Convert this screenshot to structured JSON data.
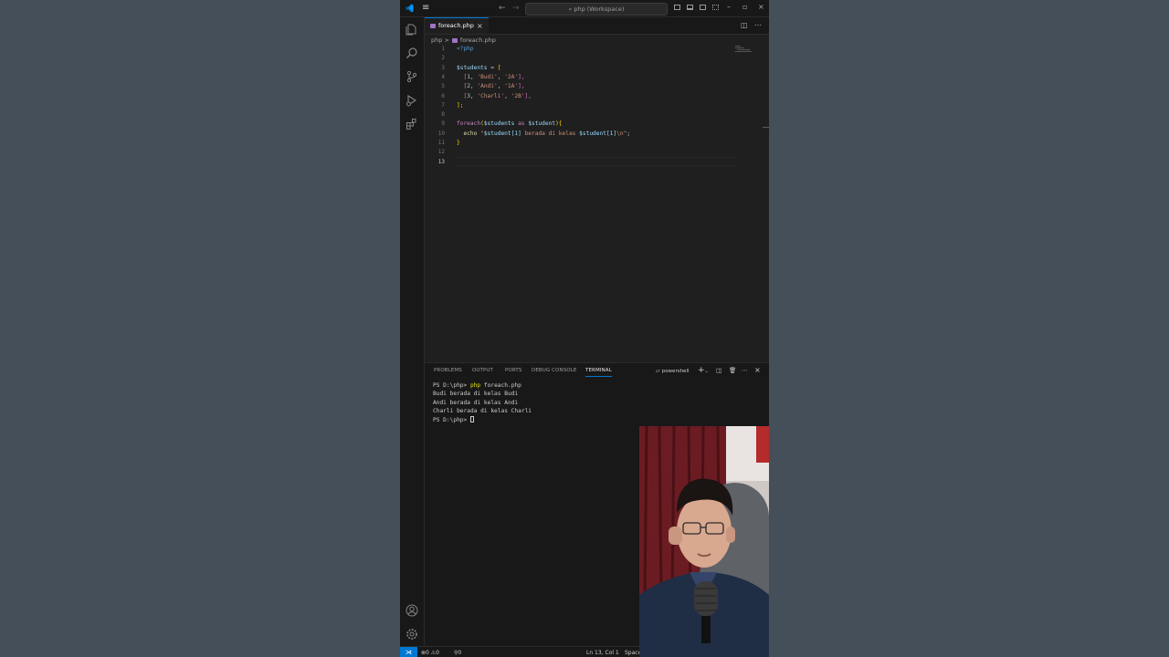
{
  "titlebar": {
    "menu_icon": "hamburger-icon",
    "search_text": "php (Workspace)",
    "colors": {
      "accent": "#0078d4",
      "bg": "#181818",
      "editor_bg": "#1f1f1f"
    }
  },
  "activity_bar": {
    "icons": [
      "explorer-icon",
      "search-icon",
      "source-control-icon",
      "run-debug-icon",
      "extensions-icon",
      "account-icon",
      "gear-icon"
    ]
  },
  "tab": {
    "label": "foreach.php",
    "close": "×"
  },
  "breadcrumb": {
    "folder": "php",
    "separator": ">",
    "file": "foreach.php"
  },
  "editor": {
    "line_numbers": [
      "1",
      "2",
      "3",
      "4",
      "5",
      "6",
      "7",
      "8",
      "9",
      "10",
      "11",
      "12",
      "13"
    ],
    "current_line": 13,
    "code": {
      "l1_tag": "<?php",
      "l3_var": "$students",
      "l3_op": " = ",
      "l3_br": "[",
      "l4": [
        "  [",
        "1",
        ", ",
        "'Budi'",
        ", ",
        "'2A'",
        "],"
      ],
      "l5": [
        "  [",
        "2",
        ", ",
        "'Andi'",
        ", ",
        "'1A'",
        "],"
      ],
      "l6": [
        "  [",
        "3",
        ", ",
        "'Charli'",
        ", ",
        "'2B'",
        "],"
      ],
      "l7": "];",
      "l9_kw": "foreach",
      "l9_open": "(",
      "l9_var1": "$students",
      "l9_as": " as ",
      "l9_var2": "$student",
      "l9_close": "){",
      "l10_echo": "  echo ",
      "l10_str_a": "\"",
      "l10_var_a": "$student[1]",
      "l10_str_b": " berada di kelas ",
      "l10_var_b": "$student[1]",
      "l10_str_c": "\\n\"",
      "l10_end": ";",
      "l11": "}"
    }
  },
  "panel": {
    "tabs": [
      "PROBLEMS",
      "OUTPUT",
      "PORTS",
      "DEBUG CONSOLE",
      "TERMINAL"
    ],
    "active_tab": "TERMINAL",
    "shell_label": "powershell",
    "add": "+",
    "terminal": {
      "prompt": "PS D:\\php> ",
      "command_kw": "php",
      "command_arg": " foreach.php",
      "output": [
        "Budi berada di kelas Budi",
        "Andi berada di kelas Andi",
        "Charli berada di kelas Charli"
      ],
      "final_prompt": "PS D:\\php> "
    }
  },
  "statusbar": {
    "errors": "0",
    "warnings": "0",
    "ports": "0",
    "position": "Ln 13, Col 1",
    "indent": "Space"
  }
}
